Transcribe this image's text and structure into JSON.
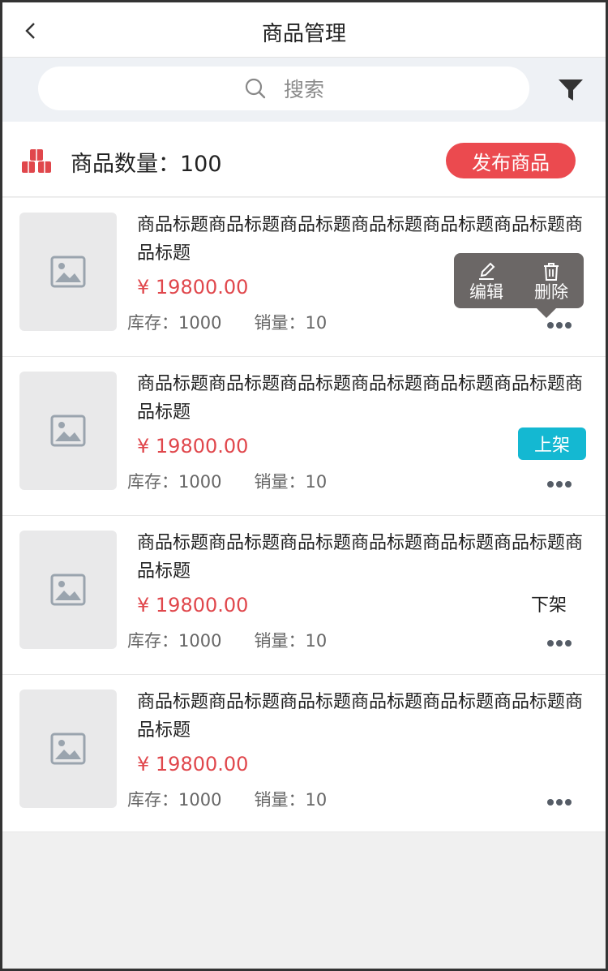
{
  "header": {
    "title": "商品管理"
  },
  "search": {
    "placeholder": "搜索"
  },
  "summary": {
    "count_label": "商品数量：100",
    "publish_label": "发布商品"
  },
  "products": [
    {
      "title": "商品标题商品标题商品标题商品标题商品标题商品标题商品标题",
      "price": "¥ 19800.00",
      "stock": "库存：1000",
      "sales": "销量：10"
    },
    {
      "title": "商品标题商品标题商品标题商品标题商品标题商品标题商品标题",
      "price": "¥ 19800.00",
      "stock": "库存：1000",
      "sales": "销量：10"
    },
    {
      "title": "商品标题商品标题商品标题商品标题商品标题商品标题商品标题",
      "price": "¥ 19800.00",
      "stock": "库存：1000",
      "sales": "销量：10"
    },
    {
      "title": "商品标题商品标题商品标题商品标题商品标题商品标题商品标题",
      "price": "¥ 19800.00",
      "stock": "库存：1000",
      "sales": "销量：10"
    }
  ],
  "popover": {
    "edit_label": "编辑",
    "delete_label": "删除"
  },
  "status": {
    "on_shelf": "上架",
    "off_shelf": "下架"
  },
  "colors": {
    "accent_red": "#eb4a4f",
    "price_red": "#e0474c",
    "chip_cyan": "#14b8d2",
    "popover_gray": "#6b6766"
  },
  "icons": [
    "back-icon",
    "search-icon",
    "filter-icon",
    "boxes-icon",
    "image-icon",
    "more-icon",
    "edit-icon",
    "trash-icon"
  ]
}
